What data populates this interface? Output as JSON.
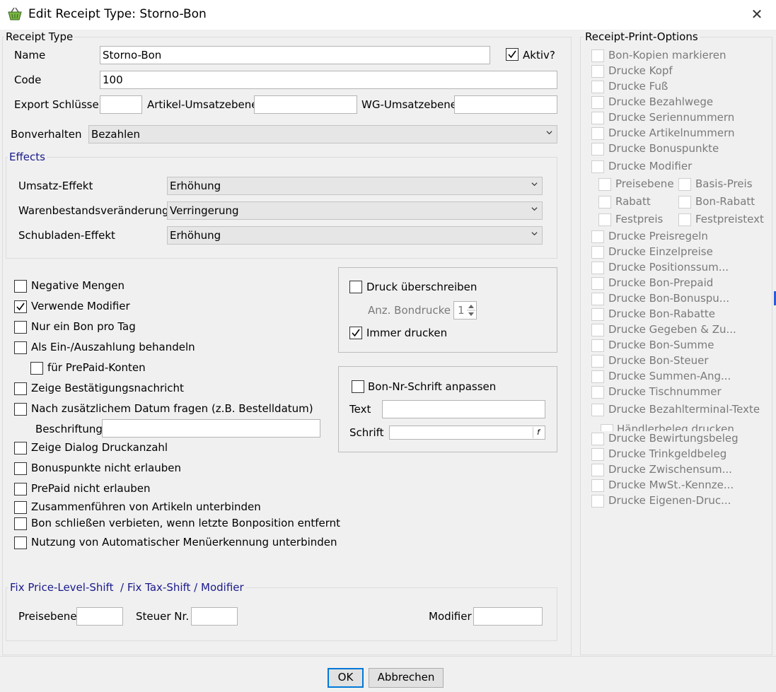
{
  "window": {
    "title": "Edit Receipt Type: Storno-Bon",
    "close_icon": "close-icon"
  },
  "receipt_type": {
    "legend": "Receipt Type",
    "name_label": "Name",
    "name_value": "Storno-Bon",
    "aktiv_label": "Aktiv?",
    "aktiv_checked": true,
    "code_label": "Code",
    "code_value": "100",
    "export_label": "Export Schlüssel",
    "export_value": "",
    "artikel_label": "Artikel-Umsatzebene",
    "artikel_value": "",
    "wg_label": "WG-Umsatzebene",
    "wg_value": "",
    "bonverhalten_label": "Bonverhalten",
    "bonverhalten_value": "Bezahlen"
  },
  "effects": {
    "legend": "Effects",
    "umsatz_label": "Umsatz-Effekt",
    "umsatz_value": "Erhöhung",
    "waren_label": "Warenbestandsveränderung",
    "waren_value": "Verringerung",
    "schub_label": "Schubladen-Effekt",
    "schub_value": "Erhöhung"
  },
  "options": [
    {
      "label": "Negative Mengen",
      "checked": false
    },
    {
      "label": "Verwende Modifier",
      "checked": true
    },
    {
      "label": "Nur ein Bon pro Tag",
      "checked": false
    },
    {
      "label": "Als Ein-/Auszahlung behandeln",
      "checked": false
    },
    {
      "label": "für PrePaid-Konten",
      "checked": false
    },
    {
      "label": "Zeige Bestätigungsnachricht",
      "checked": false
    },
    {
      "label": "Nach zusätzlichem Datum fragen (z.B. Bestelldatum)",
      "checked": false
    },
    {
      "label": "Zeige Dialog Druckanzahl",
      "checked": false
    },
    {
      "label": "Bonuspunkte nicht erlauben",
      "checked": false
    },
    {
      "label": "PrePaid nicht erlauben",
      "checked": false
    },
    {
      "label": "Zusammenführen von Artikeln unterbinden",
      "checked": false
    },
    {
      "label": "Bon schließen verbieten, wenn letzte Bonposition entfernt",
      "checked": false
    },
    {
      "label": "Nutzung von Automatischer Menüerkennung unterbinden",
      "checked": false
    }
  ],
  "beschriftung": {
    "label": "Beschriftung",
    "value": ""
  },
  "druck": {
    "override_label": "Druck überschreiben",
    "override_checked": false,
    "anzahl_label": "Anz. Bondrucke",
    "anzahl_value": "1",
    "immer_label": "Immer drucken",
    "immer_checked": true
  },
  "bonnr": {
    "label": "Bon-Nr-Schrift anpassen",
    "checked": false,
    "text_label": "Text",
    "text_value": "",
    "schrift_label": "Schrift",
    "schrift_value": ""
  },
  "fix": {
    "legend": "Fix Price-Level-Shift  / Fix Tax-Shift / Modifier",
    "preis_label": "Preisebene",
    "preis_value": "",
    "steuer_label": "Steuer Nr.",
    "steuer_value": "",
    "modifier_label": "Modifier",
    "modifier_value": ""
  },
  "print_options": {
    "legend": "Receipt-Print-Options",
    "items_top": [
      "Bon-Kopien markieren",
      "Drucke Kopf",
      "Drucke Fuß",
      "Drucke Bezahlwege",
      "Drucke Seriennummern",
      "Drucke Artikelnummern",
      "Drucke Bonuspunkte"
    ],
    "modifier_label": "Drucke Modifier",
    "sub_left": [
      "Preisebene",
      "Rabatt",
      "Festpreis"
    ],
    "sub_right": [
      "Basis-Preis",
      "Bon-Rabatt",
      "Festpreistext"
    ],
    "items_mid": [
      "Drucke Preisregeln",
      "Drucke Einzelpreise",
      "Drucke Positionssum...",
      "Drucke Bon-Prepaid",
      "Drucke Bon-Bonuspu...",
      "Drucke Bon-Rabatte",
      "Drucke Gegeben & Zu...",
      "Drucke Bon-Summe",
      "Drucke Bon-Steuer",
      "Drucke Summen-Ang...",
      "Drucke Tischnummer",
      "Drucke Bezahlterminal-Texte"
    ],
    "haendler_label": "Händlerbeleg drucken",
    "items_bottom": [
      "Drucke Bewirtungsbeleg",
      "Drucke Trinkgeldbeleg",
      "Drucke Zwischensum...",
      "Drucke MwSt.-Kennze...",
      "Drucke Eigenen-Druc..."
    ]
  },
  "buttons": {
    "ok": "OK",
    "cancel": "Abbrechen"
  }
}
